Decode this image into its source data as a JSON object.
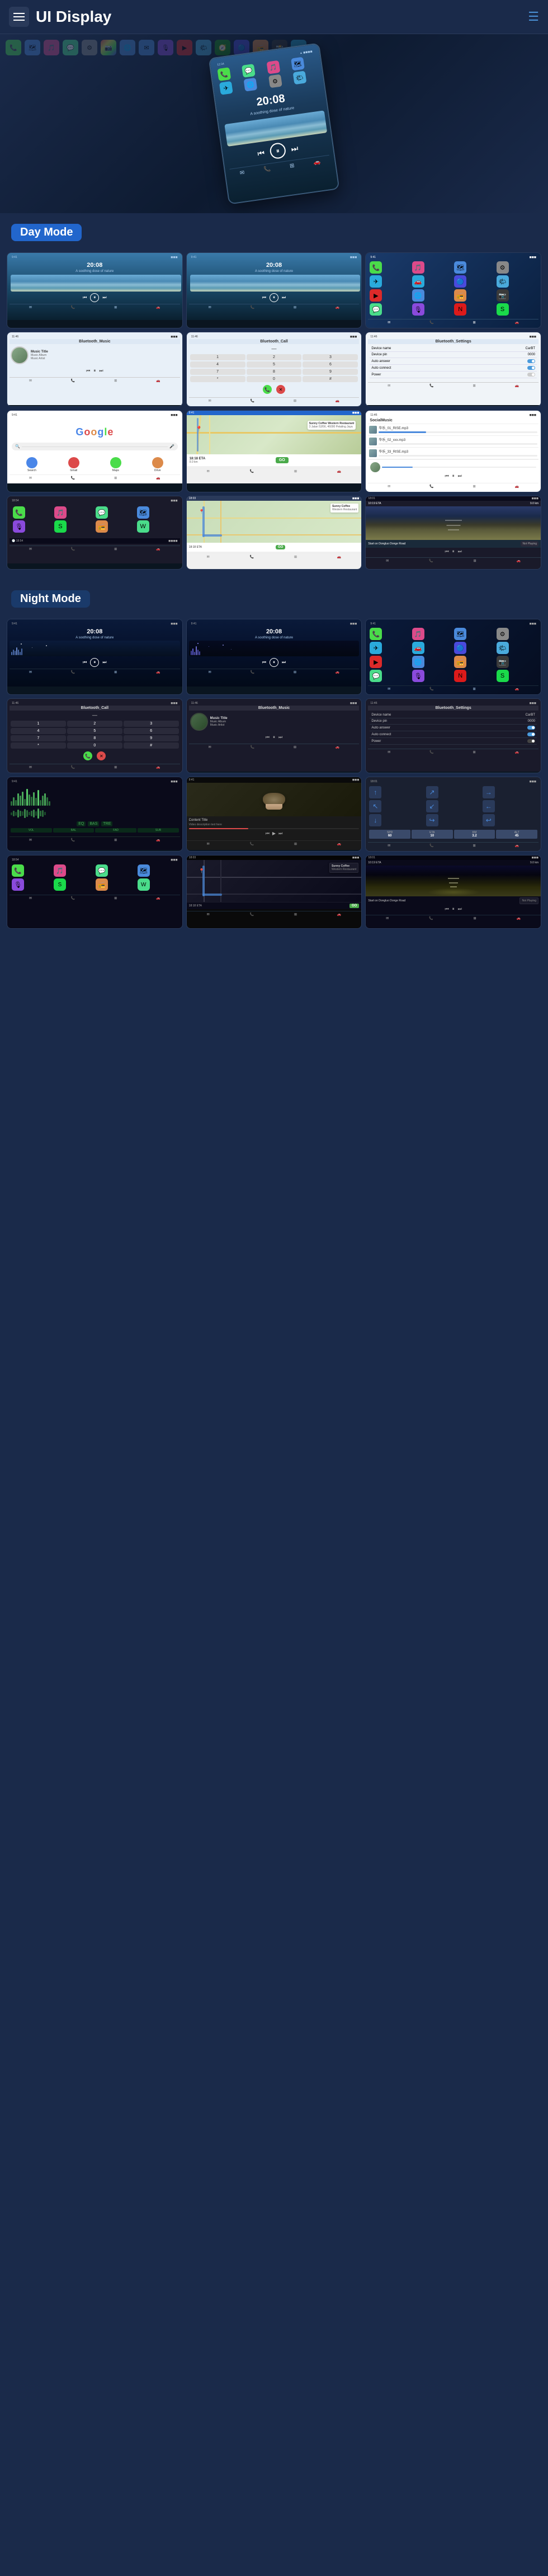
{
  "header": {
    "title": "UI Display",
    "nav_icon": "≡",
    "menu_label": "Menu"
  },
  "day_mode": {
    "label": "Day Mode"
  },
  "night_mode": {
    "label": "Night Mode"
  },
  "hero": {
    "device_time": "20:08",
    "device_subtitle": "A soothing dose of nature"
  },
  "screens": {
    "music_time": "20:08",
    "music_subtitle": "A soothing dose of nature",
    "music_title": "Music Title",
    "music_album": "Music Album",
    "music_artist": "Music Artist",
    "bluetooth_music": "Bluetooth_Music",
    "bluetooth_call": "Bluetooth_Call",
    "bluetooth_settings": "Bluetooth_Settings",
    "device_name_label": "Device name",
    "device_name_value": "CarBT",
    "device_pin_label": "Device pin",
    "device_pin_value": "0000",
    "auto_answer_label": "Auto answer",
    "auto_connect_label": "Auto connect",
    "power_label": "Power",
    "google_text": "Google",
    "sunny_coffee": "Sunny Coffee Western Restaurant",
    "restaurant_address": "3 Jalan 53/56, 46000 Petaling Jaya",
    "eta_label": "18:18 ETA",
    "eta_distance": "9.0 km",
    "go_label": "GO",
    "nav_time1": "10:19 ETA",
    "nav_distance1": "9.0 km",
    "nav_not_playing": "Not Playing",
    "start_on": "Start on Dongluo Donge Road",
    "social_music_label": "SocialMusic",
    "track1": "华乐_01_RISE.mp3",
    "track2": "华乐_02_xxx.mp3",
    "track3": "华乐_33_RISE.mp3"
  },
  "colors": {
    "primary_blue": "#2266cc",
    "bg_dark": "#1a2a4a",
    "accent_green": "#4adc8a",
    "accent_red": "#dc4a4a"
  }
}
